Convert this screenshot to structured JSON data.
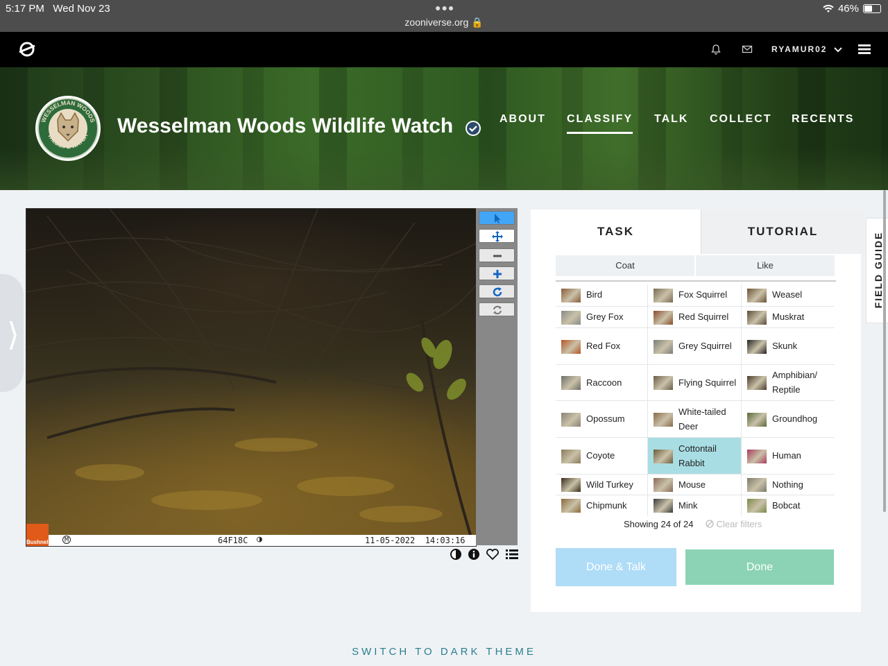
{
  "status_bar": {
    "time": "5:17 PM",
    "date": "Wed Nov 23",
    "url": "zooniverse.org",
    "battery": "46%",
    "battery_level": 0.46
  },
  "top_nav": {
    "username": "RYAMUR02"
  },
  "project": {
    "title": "Wesselman Woods Wildlife Watch",
    "badge_text_top": "WESSELMAN WOODS",
    "badge_text_bottom": "WILDLIFE WATCH",
    "nav": {
      "about": "ABOUT",
      "classify": "CLASSIFY",
      "talk": "TALK",
      "collect": "COLLECT",
      "recents": "RECENTS"
    }
  },
  "viewer": {
    "camera_id": "64F18C",
    "timestamp": "11-05-2022  14:03:16",
    "camera_brand": "Bushnell",
    "moon_symbol": "M"
  },
  "task_panel": {
    "tabs": {
      "task": "TASK",
      "tutorial": "TUTORIAL"
    },
    "filters": {
      "coat": "Coat",
      "like": "Like"
    },
    "species": [
      {
        "label": "Bird",
        "color": "#8a5a3a"
      },
      {
        "label": "Fox Squirrel",
        "color": "#7a6a50"
      },
      {
        "label": "Weasel",
        "color": "#6b5236"
      },
      {
        "label": "Grey Fox",
        "color": "#8a8a88"
      },
      {
        "label": "Red Squirrel",
        "color": "#8a4a2a"
      },
      {
        "label": "Muskrat",
        "color": "#5c4a3a"
      },
      {
        "label": "Red Fox",
        "color": "#b55422"
      },
      {
        "label": "Grey Squirrel",
        "color": "#7c7c78"
      },
      {
        "label": "Skunk",
        "color": "#222222"
      },
      {
        "label": "Raccoon",
        "color": "#6e6e6a"
      },
      {
        "label": "Flying Squirrel",
        "color": "#6a5a4a"
      },
      {
        "label": "Amphibian/ Reptile",
        "color": "#4a3a2a"
      },
      {
        "label": "Opossum",
        "color": "#8a8276"
      },
      {
        "label": "White-tailed Deer",
        "color": "#8a6a4a"
      },
      {
        "label": "Groundhog",
        "color": "#5a6a3a"
      },
      {
        "label": "Coyote",
        "color": "#8a7a5a"
      },
      {
        "label": "Cottontail Rabbit",
        "color": "#6a5a3a"
      },
      {
        "label": "Human",
        "color": "#aa3a5a"
      },
      {
        "label": "Wild Turkey",
        "color": "#3a2a1a"
      },
      {
        "label": "Mouse",
        "color": "#8a6a5a"
      },
      {
        "label": "Nothing",
        "color": "#7a7a6a"
      },
      {
        "label": "Chipmunk",
        "color": "#8a6a3a"
      },
      {
        "label": "Mink",
        "color": "#3a3a3a"
      },
      {
        "label": "Bobcat",
        "color": "#7a8a4a"
      }
    ],
    "selected_species": "Cottontail Rabbit",
    "showing": "Showing 24 of 24",
    "clear_filters": "Clear filters",
    "done_talk": "Done & Talk",
    "done": "Done"
  },
  "field_guide": "FIELD GUIDE",
  "footer": {
    "dark_theme": "SWITCH TO DARK THEME"
  }
}
